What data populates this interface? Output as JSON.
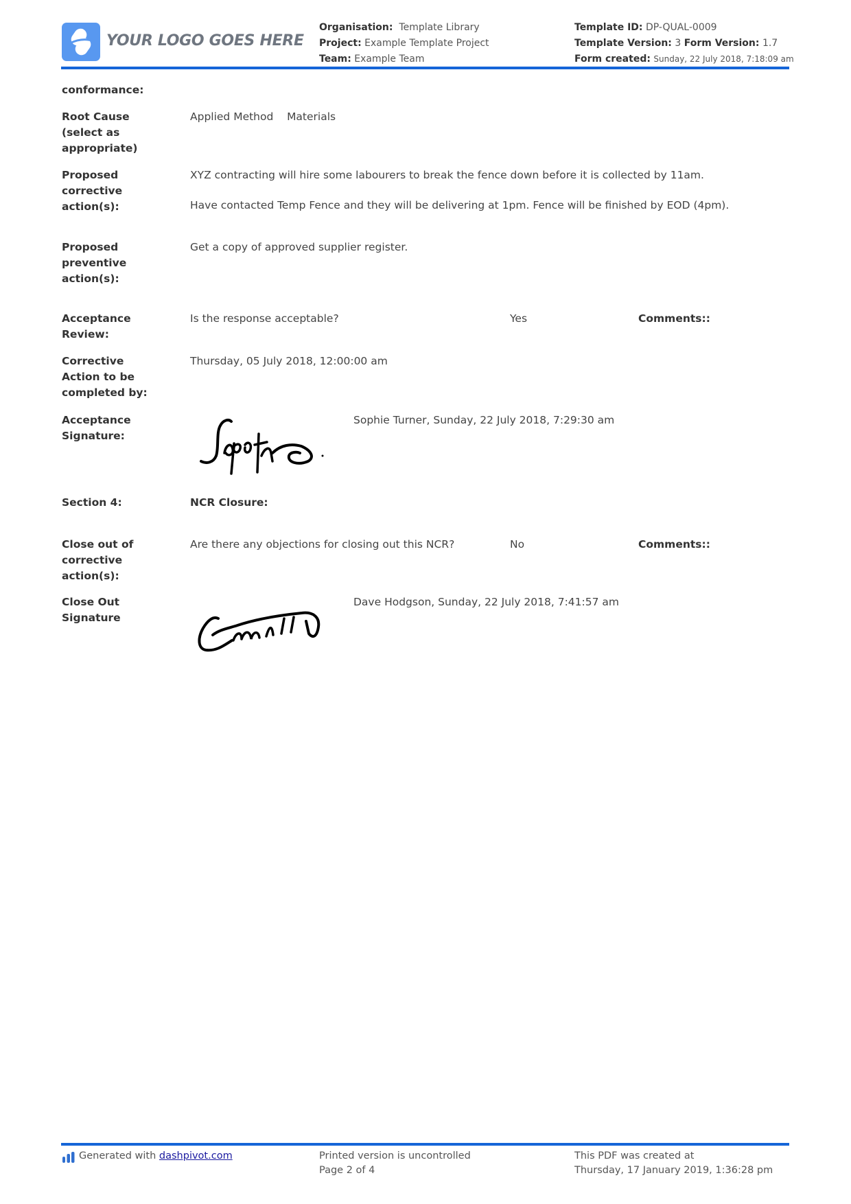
{
  "header": {
    "logo_text": "YOUR LOGO GOES HERE",
    "organisation_label": "Organisation:",
    "organisation_value": "Template Library",
    "project_label": "Project:",
    "project_value": "Example Template Project",
    "team_label": "Team:",
    "team_value": "Example Team",
    "template_id_label": "Template ID:",
    "template_id_value": "DP-QUAL-0009",
    "template_version_label": "Template Version:",
    "template_version_value": "3",
    "form_version_label": "Form Version:",
    "form_version_value": "1.7",
    "form_created_label": "Form created:",
    "form_created_value": "Sunday, 22 July 2018, 7:18:09 am",
    "accent_color": "#1565d8"
  },
  "form": {
    "conformance_label": "conformance:",
    "root_cause": {
      "label_lines": [
        "Root Cause",
        "(select as",
        "appropriate)"
      ],
      "values": [
        "Applied Method",
        "Materials"
      ]
    },
    "corrective": {
      "label_lines": [
        "Proposed",
        "corrective",
        "action(s):"
      ],
      "paragraphs": [
        "XYZ contracting will hire some labourers to break the fence down before it is collected by 11am.",
        "Have contacted Temp Fence and they will be delivering at 1pm. Fence will be finished by EOD (4pm)."
      ]
    },
    "preventive": {
      "label_lines": [
        "Proposed",
        "preventive",
        "action(s):"
      ],
      "value": "Get a copy of approved supplier register."
    },
    "acceptance_review": {
      "label_lines": [
        "Acceptance",
        "Review:"
      ],
      "question": "Is the response acceptable?",
      "answer": "Yes",
      "comments_label": "Comments::"
    },
    "completion": {
      "label_lines": [
        "Corrective",
        "Action to be",
        "completed by:"
      ],
      "value": "Thursday, 05 July 2018, 12:00:00 am"
    },
    "acceptance_signature": {
      "label_lines": [
        "Acceptance",
        "Signature:"
      ],
      "signed_by": "Sophie Turner, Sunday, 22 July 2018, 7:29:30 am"
    },
    "section4": {
      "label": "Section 4:",
      "title": "NCR Closure:"
    },
    "close_out": {
      "label_lines": [
        "Close out of",
        "corrective",
        "action(s):"
      ],
      "question": "Are there any objections for closing out this NCR?",
      "answer": "No",
      "comments_label": "Comments::"
    },
    "close_out_signature": {
      "label_lines": [
        "Close Out",
        "Signature"
      ],
      "signed_by": "Dave Hodgson, Sunday, 22 July 2018, 7:41:57 am"
    }
  },
  "footer": {
    "generated_prefix": "Generated with ",
    "generated_link": "dashpivot.com",
    "uncontrolled": "Printed version is uncontrolled",
    "page": "Page 2 of 4",
    "pdf_created_label": "This PDF was created at",
    "pdf_created_value": "Thursday, 17 January 2019, 1:36:28 pm"
  }
}
